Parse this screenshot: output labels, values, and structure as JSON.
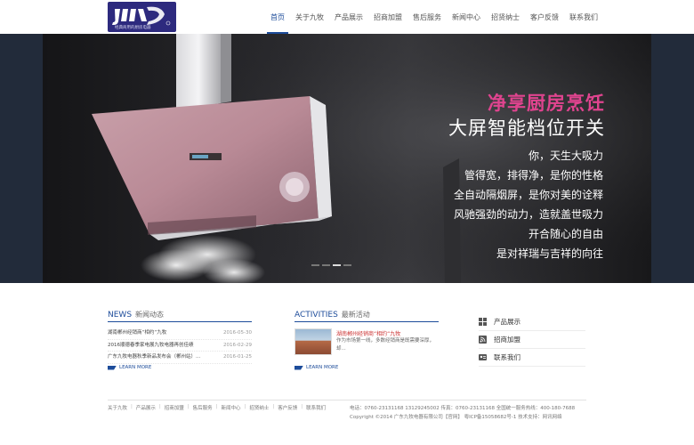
{
  "logo": {
    "tagline": "经典商用的厨房电器"
  },
  "nav": [
    {
      "label": "首页",
      "active": true
    },
    {
      "label": "关于九牧"
    },
    {
      "label": "产品展示"
    },
    {
      "label": "招商加盟"
    },
    {
      "label": "售后服务"
    },
    {
      "label": "新闻中心"
    },
    {
      "label": "招贤纳士"
    },
    {
      "label": "客户反馈"
    },
    {
      "label": "联系我们"
    }
  ],
  "banner": {
    "headline_pink": "净享厨房烹饪",
    "headline_white": "大屏智能档位开关",
    "slogans": [
      "你，天生大吸力",
      "管得宽，排得净，是你的性格",
      "全自动隔烟屏，是你对美的诠释",
      "风驰强劲的动力，造就盖世吸力",
      "开合随心的自由",
      "是对祥瑞与吉祥的向往"
    ],
    "slide_count": 4,
    "active_slide": 3
  },
  "news": {
    "title_en": "NEWS",
    "title_cn": "新闻动态",
    "items": [
      {
        "title": "湖南郴州经销商“相约“九牧",
        "date": "2016-05-30"
      },
      {
        "title": "2016顺德春季家电展九牧电器再创佳绩",
        "date": "2016-02-29"
      },
      {
        "title": "广东九牧电器秋季新品发布会（郴州站）...",
        "date": "2016-01-25"
      }
    ],
    "more": "LEARN MORE"
  },
  "activities": {
    "title_en": "ACTIVITIES",
    "title_cn": "最新活动",
    "item_title": "湖南郴州经销商“相约“九牧",
    "item_desc": "作为市场第一线，多数经销商是既需要深厚，却...",
    "more": "LEARN MORE"
  },
  "quick_links": [
    {
      "label": "产品展示",
      "icon": "grid-icon"
    },
    {
      "label": "招商加盟",
      "icon": "rss-icon"
    },
    {
      "label": "联系我们",
      "icon": "contact-card-icon"
    }
  ],
  "footer": {
    "links": [
      "关于九牧",
      "产品展示",
      "招商加盟",
      "售后服务",
      "新闻中心",
      "招贤纳士",
      "客户反馈",
      "联系我们"
    ],
    "contact": "电话：0760-23131168 13129245002   传真：0760-23131168   全国统一服务热线：400-180-7688",
    "copyright": "Copyright ©2014 广东九牧电器有限公司【官网】 粤ICP备15058682号-1  技术支持：网讯网络"
  },
  "colors": {
    "brand": "#1d4c9a",
    "accent_pink": "#e0448f",
    "logo_bg": "#2d2a7e"
  }
}
